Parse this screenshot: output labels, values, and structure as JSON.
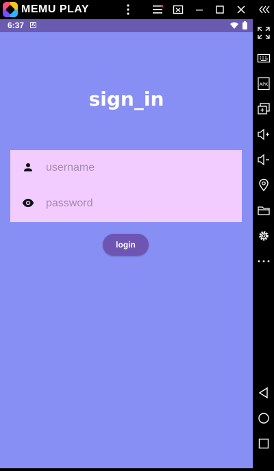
{
  "emulator": {
    "brand_name": "MEMU PLAY",
    "titlebar_icons": [
      "more-vert-icon",
      "menu-icon",
      "screenshot-icon",
      "minimize-icon",
      "maximize-icon",
      "close-icon",
      "collapse-sidebar-icon"
    ],
    "sidebar_icons": [
      "fullscreen-icon",
      "keyboard-icon",
      "apk-icon",
      "multi-instance-icon",
      "volume-up-icon",
      "volume-down-icon",
      "location-icon",
      "folder-icon",
      "settings-icon",
      "more-icon",
      "back-icon",
      "home-icon",
      "recents-icon"
    ],
    "apk_label": "APK"
  },
  "status_bar": {
    "time": "6:37",
    "app_indicator": "A",
    "background": "#6a5bb0"
  },
  "app": {
    "title": "sign_in",
    "background": "#878ff5",
    "form": {
      "background": "#f2ccff",
      "username_placeholder": "username",
      "password_placeholder": "password"
    },
    "login_label": "login",
    "button_color": "#6e55b4"
  }
}
